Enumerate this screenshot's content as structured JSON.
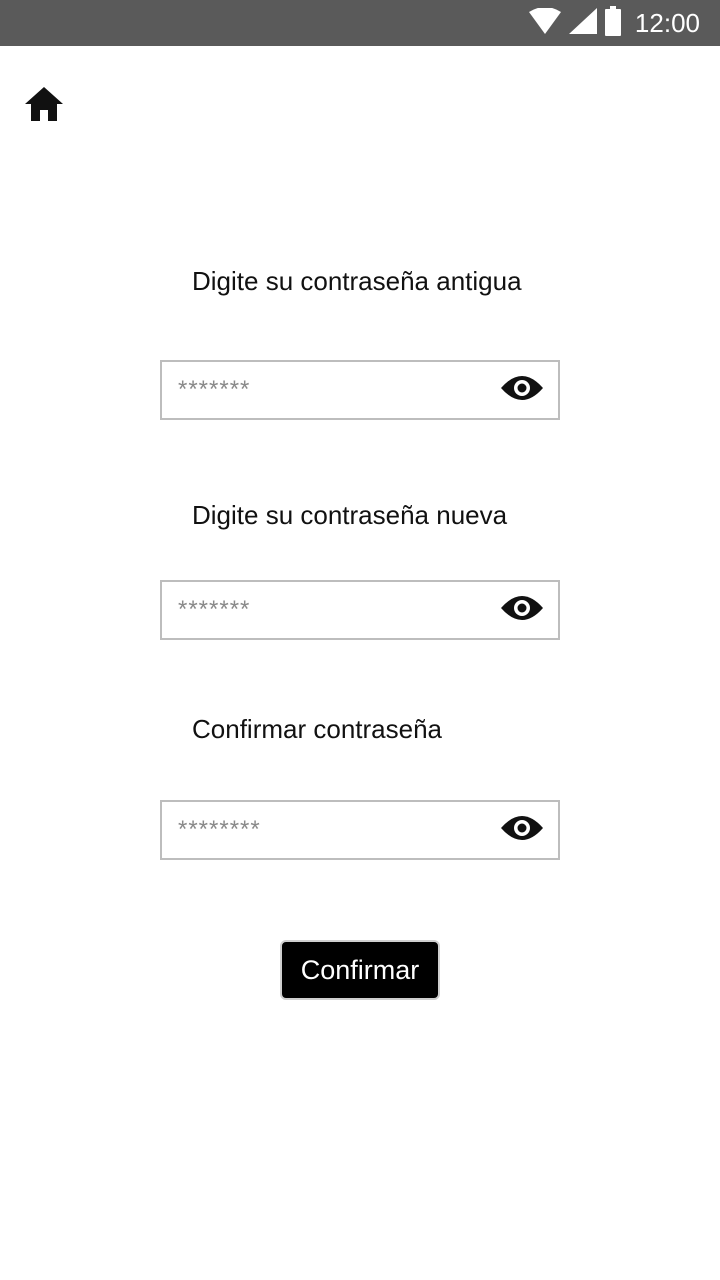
{
  "status_bar": {
    "time": "12:00",
    "icons": [
      "wifi-icon",
      "signal-icon",
      "battery-icon"
    ],
    "background": "#5a5a5a"
  },
  "header": {
    "home_icon": "home-icon"
  },
  "form": {
    "old_password": {
      "label": "Digite su contraseña antigua",
      "placeholder": "*******"
    },
    "new_password": {
      "label": "Digite su contraseña nueva",
      "placeholder": "*******"
    },
    "confirm_password": {
      "label": "Confirmar contraseña",
      "placeholder": "********"
    },
    "visibility_icon": "eye-icon",
    "submit_label": "Confirmar"
  },
  "colors": {
    "button_bg": "#000000",
    "button_text": "#ffffff",
    "field_border": "#bdbdbd"
  }
}
